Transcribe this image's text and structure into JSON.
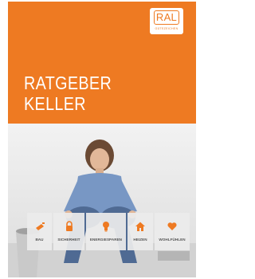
{
  "colors": {
    "brand_orange": "#ee7a22",
    "panel_grey": "#ececec",
    "label_grey": "#555555"
  },
  "logo": {
    "mark": "RAL",
    "subline": "GÜTEZEICHEN"
  },
  "title": {
    "line1": "RATGEBER",
    "line2": "KELLER"
  },
  "categories": [
    {
      "label": "BAU",
      "icon": "trowel-icon"
    },
    {
      "label": "SICHERHEIT",
      "icon": "padlock-icon"
    },
    {
      "label": "ENERGIESPAREN",
      "icon": "lightbulb-icon"
    },
    {
      "label": "HEIZEN",
      "icon": "house-icon"
    },
    {
      "label": "WOHLFÜHLEN",
      "icon": "heart-icon"
    }
  ]
}
